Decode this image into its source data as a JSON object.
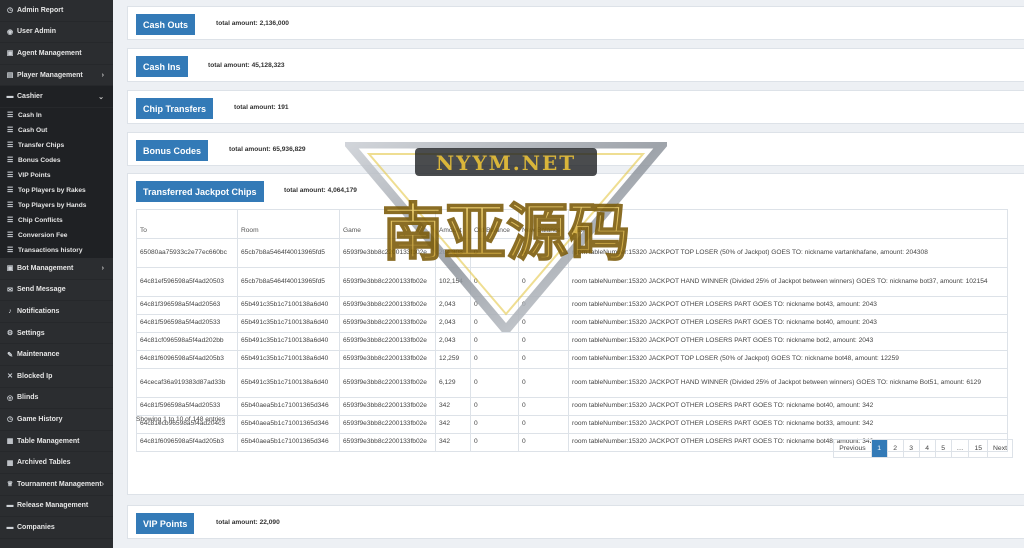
{
  "sidebar": {
    "items": [
      {
        "icon": "◷",
        "label": "Admin Report"
      },
      {
        "icon": "◉",
        "label": "User Admin"
      },
      {
        "icon": "▣",
        "label": "Agent Management"
      },
      {
        "icon": "▤",
        "label": "Player Management",
        "chev": "›"
      },
      {
        "icon": "▬",
        "label": "Cashier",
        "chev": "⌄"
      }
    ],
    "cashier_sub": [
      "Cash In",
      "Cash Out",
      "Transfer Chips",
      "Bonus Codes",
      "VIP Points",
      "Top Players by Rakes",
      "Top Players by Hands",
      "Chip Conflicts",
      "Conversion Fee",
      "Transactions history"
    ],
    "items2": [
      {
        "icon": "▣",
        "label": "Bot Management",
        "chev": "›"
      },
      {
        "icon": "✉",
        "label": "Send Message"
      },
      {
        "icon": "♪",
        "label": "Notifications"
      },
      {
        "icon": "⚙",
        "label": "Settings"
      },
      {
        "icon": "✎",
        "label": "Maintenance"
      },
      {
        "icon": "✕",
        "label": "Blocked Ip"
      },
      {
        "icon": "◎",
        "label": "Blinds"
      },
      {
        "icon": "◷",
        "label": "Game History"
      },
      {
        "icon": "▦",
        "label": "Table Management"
      },
      {
        "icon": "▦",
        "label": "Archived Tables"
      },
      {
        "icon": "♕",
        "label": "Tournament Management",
        "chev": "›"
      },
      {
        "icon": "▬",
        "label": "Release Management"
      },
      {
        "icon": "▬",
        "label": "Companies"
      }
    ]
  },
  "panels": [
    {
      "label": "Cash Outs",
      "total": "total amount: 2,136,000"
    },
    {
      "label": "Cash Ins",
      "total": "total amount: 45,128,323"
    },
    {
      "label": "Chip Transfers",
      "total": "total amount: 191"
    },
    {
      "label": "Bonus Codes",
      "total": "total amount: 65,936,829"
    },
    {
      "label": "Transferred Jackpot Chips",
      "total": "total amount: 4,064,179"
    },
    {
      "label": "VIP Points",
      "total": "total amount: 22,090"
    }
  ],
  "table": {
    "headers": [
      "To",
      "Room",
      "Game",
      "Amount",
      "Old Balance",
      "New Balance",
      "Note"
    ],
    "rows": [
      [
        "65080aa75933c2e77ec660bc",
        "65cb7b8a5464f40013965fd5",
        "6593f9e3bb8c2200133fb02e",
        "204,308",
        "0",
        "0",
        "room tableNumber:15320 JACKPOT TOP LOSER (50% of Jackpot) GOES TO: nickname vartankhafane, amount: 204308"
      ],
      [
        "64c81ef596598a5f4ad20503",
        "65cb7b8a5464f40013965fd5",
        "6593f9e3bb8c2200133fb02e",
        "102,154",
        "0",
        "0",
        "room tableNumber:15320 JACKPOT HAND WINNER (Divided 25% of Jackpot between winners) GOES TO: nickname bot37, amount: 102154"
      ],
      [
        "64c81f396598a5f4ad20563",
        "65b491c35b1c7100138a6d40",
        "6593f9e3bb8c2200133fb02e",
        "2,043",
        "0",
        "0",
        "room tableNumber:15320 JACKPOT OTHER LOSERS PART GOES TO: nickname bot43, amount: 2043"
      ],
      [
        "64c81f596598a5f4ad20533",
        "65b491c35b1c7100138a6d40",
        "6593f9e3bb8c2200133fb02e",
        "2,043",
        "0",
        "0",
        "room tableNumber:15320 JACKPOT OTHER LOSERS PART GOES TO: nickname bot40, amount: 2043"
      ],
      [
        "64c81cf096598a5f4ad202bb",
        "65b491c35b1c7100138a6d40",
        "6593f9e3bb8c2200133fb02e",
        "2,043",
        "0",
        "0",
        "room tableNumber:15320 JACKPOT OTHER LOSERS PART GOES TO: nickname bot2, amount: 2043"
      ],
      [
        "64c81f6096598a5f4ad205b3",
        "65b491c35b1c7100138a6d40",
        "6593f9e3bb8c2200133fb02e",
        "12,259",
        "0",
        "0",
        "room tableNumber:15320 JACKPOT TOP LOSER (50% of Jackpot) GOES TO: nickname bot48, amount: 12259"
      ],
      [
        "64cecaf36a919383d87ad33b",
        "65b491c35b1c7100138a6d40",
        "6593f9e3bb8c2200133fb02e",
        "6,129",
        "0",
        "0",
        "room tableNumber:15320 JACKPOT HAND WINNER (Divided 25% of Jackpot between winners) GOES TO: nickname Bot51, amount: 6129"
      ],
      [
        "64c81f596598a5f4ad20533",
        "65b40aea5b1c71001365d346",
        "6593f9e3bb8c2200133fb02e",
        "342",
        "0",
        "0",
        "room tableNumber:15320 JACKPOT OTHER LOSERS PART GOES TO: nickname bot40, amount: 342"
      ],
      [
        "64c81ecb96598a5f4ad204c3",
        "65b40aea5b1c71001365d346",
        "6593f9e3bb8c2200133fb02e",
        "342",
        "0",
        "0",
        "room tableNumber:15320 JACKPOT OTHER LOSERS PART GOES TO: nickname bot33, amount: 342"
      ],
      [
        "64c81f6096598a5f4ad205b3",
        "65b40aea5b1c71001365d346",
        "6593f9e3bb8c2200133fb02e",
        "342",
        "0",
        "0",
        "room tableNumber:15320 JACKPOT OTHER LOSERS PART GOES TO: nickname bot48, amount: 342"
      ]
    ],
    "showing": "Showing 1 to 10 of 148 entries"
  },
  "pager": [
    "Previous",
    "1",
    "2",
    "3",
    "4",
    "5",
    "…",
    "15",
    "Next"
  ],
  "pager_current": "1",
  "watermark": {
    "top": "NYYM.NET",
    "big": "南亚源码"
  },
  "colors": {
    "accent": "#337ab7",
    "sidebar": "#2b2d30",
    "watermark_gold": "#d9b53a"
  }
}
